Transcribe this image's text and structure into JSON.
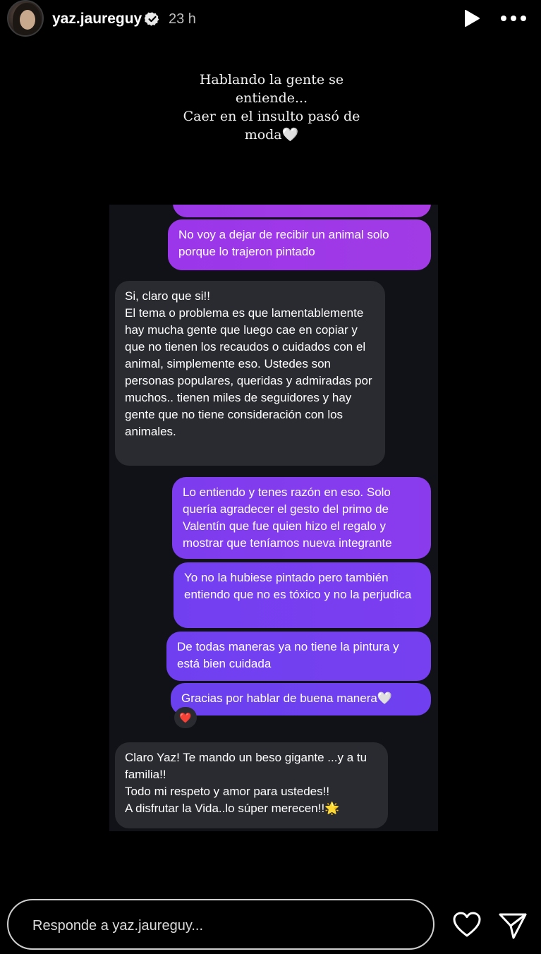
{
  "header": {
    "username": "yaz.jaureguy",
    "time_ago": "23 h"
  },
  "caption": {
    "line1": "Hablando la gente se",
    "line2": "entiende...",
    "line3": "Caer en el insulto pasó de",
    "line4": "moda🤍"
  },
  "chat": {
    "messages": [
      {
        "type": "sent",
        "text": "No voy a dejar de recibir un animal solo porque lo trajeron pintado"
      },
      {
        "type": "received",
        "text": "Si, claro que si!!\nEl tema o problema es que lamentablemente hay mucha gente que luego cae en copiar y que no tienen los recaudos o cuidados con el animal, simplemente eso. Ustedes son personas populares, queridas y admiradas por muchos.. tienen miles de seguidores y hay gente que no tiene consideración con los animales."
      },
      {
        "type": "sent",
        "text": "Lo entiendo y tenes razón en eso. Solo quería agradecer el gesto del primo de Valentín que fue quien hizo el regalo y mostrar que teníamos nueva integrante"
      },
      {
        "type": "sent",
        "text": "Yo no la hubiese pintado pero también entiendo que no es tóxico y no la perjudica"
      },
      {
        "type": "sent",
        "text": "De todas maneras ya no tiene la pintura y está bien cuidada"
      },
      {
        "type": "sent",
        "text": "Gracias por hablar de buena manera🤍"
      },
      {
        "type": "received",
        "text": "Claro Yaz!  Te mando un beso gigante ...y a tu familia!!\nTodo mi respeto y amor para ustedes!!\nA disfrutar la Vida..lo súper merecen!!🌟"
      }
    ],
    "reaction": "❤️"
  },
  "footer": {
    "reply_placeholder": "Responde a yaz.jaureguy..."
  },
  "colors": {
    "background": "#000000",
    "received_bubble": "#2a2b30",
    "sent_bubble_purple": "#7a3ff0",
    "sent_bubble_magenta": "#a737e6"
  },
  "icons": [
    "verified-badge-icon",
    "play-icon",
    "more-icon",
    "heart-icon",
    "send-icon"
  ]
}
